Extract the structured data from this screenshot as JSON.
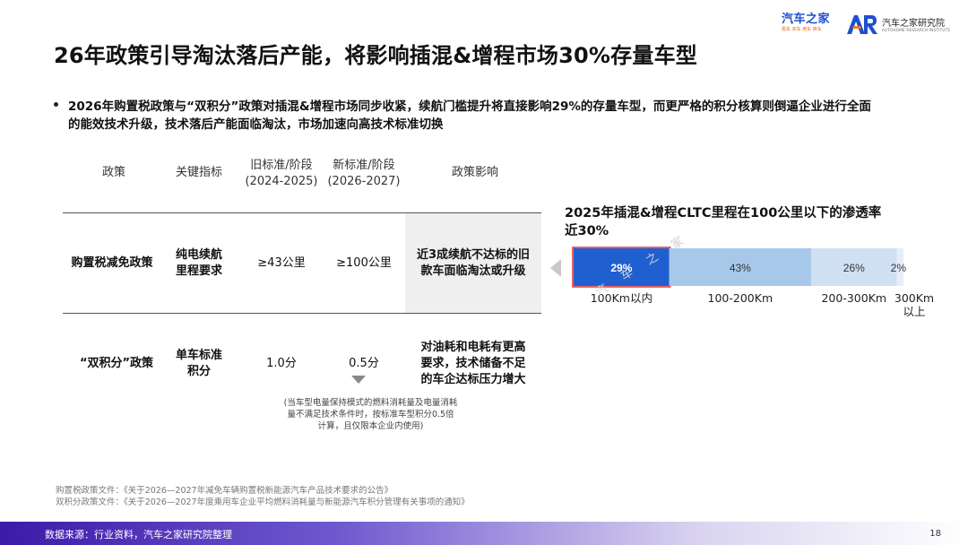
{
  "header": {
    "brand_name": "汽车之家",
    "brand_tags": "看车 买车 用车 换车",
    "institute_name": "汽车之家研究院",
    "institute_en": "AUTOHOME RESEARCH INSTITUTE"
  },
  "title": "26年政策引导淘汰落后产能，将影响插混&增程市场30%存量车型",
  "bullet": "2026年购置税政策与“双积分”政策对插混&增程市场同步收紧，续航门槛提升将直接影响29%的存量车型，而更严格的积分核算则倒逼企业进行全面的能效技术升级，技术落后产能面临淘汰，市场加速向高技术标准切换",
  "table": {
    "headers": [
      "政策",
      "关键指标",
      "旧标准/阶段\n(2024-2025)",
      "新标准/阶段\n(2026-2027)",
      "政策影响"
    ],
    "rows": [
      {
        "policy": "购置税减免政策",
        "indicator": "纯电续航\n里程要求",
        "old": "≥43公里",
        "new": "≥100公里",
        "impact": "近3成续航不达标的旧\n款车面临淘汰或升级"
      },
      {
        "policy": "“双积分”政策",
        "indicator": "单车标准\n积分",
        "old": "1.0分",
        "new": "0.5分",
        "impact": "对油耗和电耗有更高\n要求，技术储备不足\n的车企达标压力增大"
      }
    ],
    "footnote": "(当车型电量保持模式的燃料消耗量及电量消耗量不满足技术条件时，按标准车型积分0.5倍计算，且仅限本企业内使用)"
  },
  "chart_title": "2025年插混&增程CLTC里程在100公里以下的渗透率近30%",
  "chart_data": {
    "type": "bar",
    "orientation": "horizontal-stacked",
    "categories": [
      "100Km以内",
      "100-200Km",
      "200-300Km",
      "300Km\n以上"
    ],
    "values": [
      29,
      43,
      26,
      2
    ],
    "value_labels": [
      "29%",
      "43%",
      "26%",
      "2%"
    ],
    "unit": "%",
    "colors": [
      "#1f5fd0",
      "#a8c8ea",
      "#cfe0f3",
      "#e6eef8"
    ],
    "highlight_index": 0,
    "highlight_color": "#e03030"
  },
  "watermark": "汽 车 之 家",
  "sources": [
    "购置税政策文件：《关于2026—2027年减免车辆购置税新能源汽车产品技术要求的公告》",
    "双积分政策文件：《关于2026—2027年度乘用车企业平均燃料消耗量与新能源汽车积分管理有关事项的通知》"
  ],
  "footer": {
    "source": "数据来源：行业资料，汽车之家研究院整理",
    "page": "18"
  }
}
